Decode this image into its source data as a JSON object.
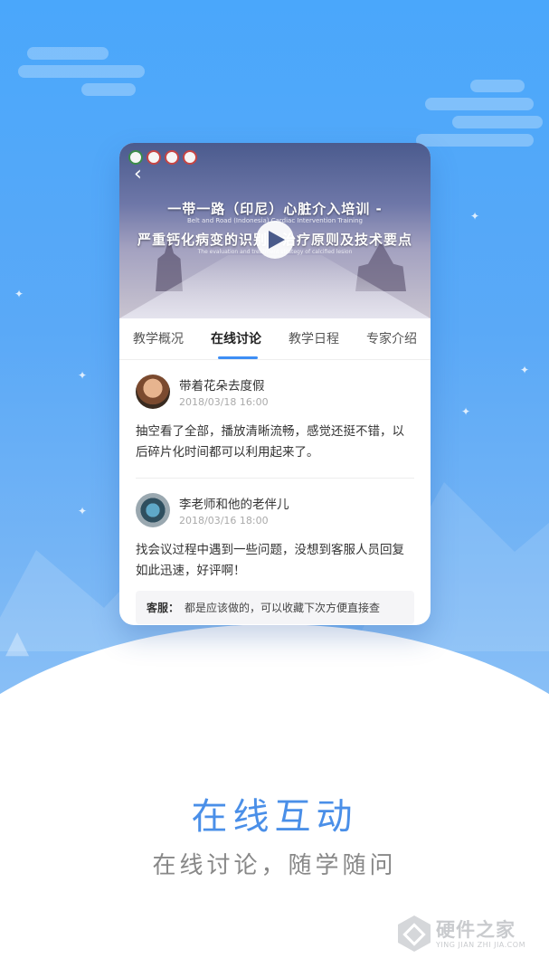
{
  "video": {
    "back_icon": "chevron-left-icon",
    "play_icon": "play-icon",
    "title_line1": "一带一路（印尼）心脏介入培训 -",
    "subtitle_line1": "Belt and Road (Indonesia) Cardiac Intervention Training",
    "title_line2": "严重钙化病变的识别、治疗原则及技术要点",
    "subtitle_line2": "The evaluation and treatment strategy of calcified lesion"
  },
  "tabs": [
    {
      "label": "教学概况"
    },
    {
      "label": "在线讨论"
    },
    {
      "label": "教学日程"
    },
    {
      "label": "专家介绍"
    }
  ],
  "active_tab": "在线讨论",
  "comments": [
    {
      "user": "带着花朵去度假",
      "time": "2018/03/18 16:00",
      "body": "抽空看了全部，播放清晰流畅，感觉还挺不错，以后碎片化时间都可以利用起来了。"
    },
    {
      "user": "李老师和他的老伴儿",
      "time": "2018/03/16 18:00",
      "body": "找会议过程中遇到一些问题，没想到客服人员回复如此迅速，好评啊！",
      "reply": {
        "label": "客服：",
        "text": "都是应该做的，可以收藏下次方便直接查"
      }
    }
  ],
  "headline": "在线互动",
  "subheadline": "在线讨论，随学随问",
  "watermark": {
    "name": "硬件之家",
    "domain": "YING JIAN ZHI JIA.COM"
  },
  "colors": {
    "accent": "#3d8ef5",
    "headline": "#4a8fe8",
    "background_top": "#4aa7fb"
  }
}
